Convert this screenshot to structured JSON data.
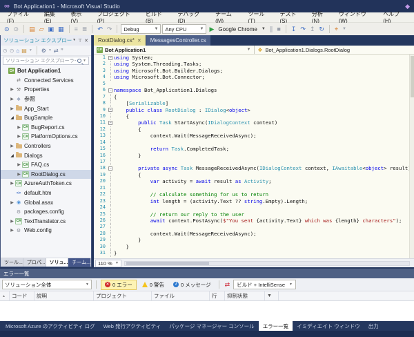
{
  "window": {
    "title": "Bot Application1 - Microsoft Visual Studio"
  },
  "menu": {
    "items": [
      "ファイル(F)",
      "編集(E)",
      "表示(V)",
      "プロジェクト(P)",
      "ビルド(B)",
      "デバッグ(D)",
      "チーム(M)",
      "ツール(T)",
      "テスト(S)",
      "分析(N)",
      "ウィンドウ(W)",
      "ヘルプ(H)"
    ]
  },
  "toolbar": {
    "config": "Debug",
    "platform": "Any CPU",
    "run_target": "Google Chrome"
  },
  "solution_explorer": {
    "title": "ソリューション エクスプローラー",
    "search_placeholder": "ソリューション エクスプローラー の検...",
    "tree": [
      {
        "label": "Bot Application1",
        "lvl": 0,
        "icon": "proj",
        "arrow": "none",
        "sel": false
      },
      {
        "label": "Connected Services",
        "lvl": 1,
        "icon": "svc",
        "arrow": "none",
        "sel": false
      },
      {
        "label": "Properties",
        "lvl": 1,
        "icon": "wrench",
        "arrow": "right",
        "sel": false
      },
      {
        "label": "参照",
        "lvl": 1,
        "icon": "ref",
        "arrow": "right",
        "sel": false
      },
      {
        "label": "App_Start",
        "lvl": 1,
        "icon": "folder",
        "arrow": "right",
        "sel": false
      },
      {
        "label": "BugSample",
        "lvl": 1,
        "icon": "folder",
        "arrow": "down",
        "sel": false
      },
      {
        "label": "BugReport.cs",
        "lvl": 2,
        "icon": "cs",
        "arrow": "right",
        "sel": false
      },
      {
        "label": "PlatformOptions.cs",
        "lvl": 2,
        "icon": "cs",
        "arrow": "right",
        "sel": false
      },
      {
        "label": "Controllers",
        "lvl": 1,
        "icon": "folder",
        "arrow": "right",
        "sel": false
      },
      {
        "label": "Dialogs",
        "lvl": 1,
        "icon": "folder",
        "arrow": "down",
        "sel": false
      },
      {
        "label": "FAQ.cs",
        "lvl": 2,
        "icon": "cs",
        "arrow": "right",
        "sel": false
      },
      {
        "label": "RootDialog.cs",
        "lvl": 2,
        "icon": "cs",
        "arrow": "right",
        "sel": true
      },
      {
        "label": "AzureAuthToken.cs",
        "lvl": 1,
        "icon": "cs",
        "arrow": "right",
        "sel": false
      },
      {
        "label": "default.htm",
        "lvl": 1,
        "icon": "htm",
        "arrow": "none",
        "sel": false
      },
      {
        "label": "Global.asax",
        "lvl": 1,
        "icon": "asax",
        "arrow": "right",
        "sel": false
      },
      {
        "label": "packages.config",
        "lvl": 1,
        "icon": "cfg",
        "arrow": "none",
        "sel": false
      },
      {
        "label": "TextTranslator.cs",
        "lvl": 1,
        "icon": "cs",
        "arrow": "right",
        "sel": false
      },
      {
        "label": "Web.config",
        "lvl": 1,
        "icon": "cfg",
        "arrow": "right",
        "sel": false
      }
    ],
    "bottom_tabs": [
      {
        "label": "ツール...",
        "state": "normal"
      },
      {
        "label": "プロパ...",
        "state": "normal"
      },
      {
        "label": "ソリュ...",
        "state": "active"
      },
      {
        "label": "チーム...",
        "state": "team"
      }
    ]
  },
  "editor": {
    "tabs": [
      {
        "label": "RootDialog.cs",
        "modified": "*",
        "active": true
      },
      {
        "label": "MessagesController.cs",
        "modified": "",
        "active": false
      }
    ],
    "breadcrumb_left": "Bot Application1",
    "breadcrumb_right": "Bot_Application1.Dialogs.RootDialog",
    "zoom": "110 %",
    "lines": [
      {
        "n": 1,
        "f": "b",
        "seg": [
          [
            "k",
            "using"
          ],
          [
            "p",
            " System;"
          ]
        ]
      },
      {
        "n": 2,
        "f": "v",
        "seg": [
          [
            "k",
            "using"
          ],
          [
            "p",
            " System.Threading.Tasks;"
          ]
        ]
      },
      {
        "n": 3,
        "f": "v",
        "seg": [
          [
            "k",
            "using"
          ],
          [
            "p",
            " Microsoft.Bot.Builder.Dialogs;"
          ]
        ]
      },
      {
        "n": 4,
        "f": "v",
        "seg": [
          [
            "k",
            "using"
          ],
          [
            "p",
            " Microsoft.Bot.Connector;"
          ]
        ]
      },
      {
        "n": 5,
        "f": "",
        "seg": []
      },
      {
        "n": 6,
        "f": "b",
        "seg": [
          [
            "k",
            "namespace"
          ],
          [
            "p",
            " Bot_Application1.Dialogs"
          ]
        ]
      },
      {
        "n": 7,
        "f": "v",
        "seg": [
          [
            "p",
            "{"
          ]
        ]
      },
      {
        "n": 8,
        "f": "v",
        "seg": [
          [
            "p",
            "    ["
          ],
          [
            "t",
            "Serializable"
          ],
          [
            "p",
            "]"
          ]
        ]
      },
      {
        "n": 9,
        "f": "b",
        "seg": [
          [
            "p",
            "    "
          ],
          [
            "k",
            "public"
          ],
          [
            "p",
            " "
          ],
          [
            "k",
            "class"
          ],
          [
            "p",
            " "
          ],
          [
            "t",
            "RootDialog"
          ],
          [
            "p",
            " : "
          ],
          [
            "t",
            "IDialog"
          ],
          [
            "p",
            "<"
          ],
          [
            "k",
            "object"
          ],
          [
            "p",
            ">"
          ]
        ]
      },
      {
        "n": 10,
        "f": "v",
        "seg": [
          [
            "p",
            "    {"
          ]
        ]
      },
      {
        "n": 11,
        "f": "b",
        "seg": [
          [
            "p",
            "        "
          ],
          [
            "k",
            "public"
          ],
          [
            "p",
            " "
          ],
          [
            "t",
            "Task"
          ],
          [
            "p",
            " StartAsync("
          ],
          [
            "t",
            "IDialogContext"
          ],
          [
            "p",
            " context)"
          ]
        ]
      },
      {
        "n": 12,
        "f": "v",
        "seg": [
          [
            "p",
            "        {"
          ]
        ]
      },
      {
        "n": 13,
        "f": "v",
        "seg": [
          [
            "p",
            "            context.Wait(MessageReceivedAsync);"
          ]
        ]
      },
      {
        "n": 14,
        "f": "v",
        "seg": []
      },
      {
        "n": 15,
        "f": "v",
        "seg": [
          [
            "p",
            "            "
          ],
          [
            "k",
            "return"
          ],
          [
            "p",
            " "
          ],
          [
            "t",
            "Task"
          ],
          [
            "p",
            ".CompletedTask;"
          ]
        ]
      },
      {
        "n": 16,
        "f": "v",
        "seg": [
          [
            "p",
            "        }"
          ]
        ]
      },
      {
        "n": 17,
        "f": "v",
        "seg": []
      },
      {
        "n": 18,
        "f": "b",
        "seg": [
          [
            "p",
            "        "
          ],
          [
            "k",
            "private"
          ],
          [
            "p",
            " "
          ],
          [
            "k",
            "async"
          ],
          [
            "p",
            " "
          ],
          [
            "t",
            "Task"
          ],
          [
            "p",
            " MessageReceivedAsync("
          ],
          [
            "t",
            "IDialogContext"
          ],
          [
            "p",
            " context, "
          ],
          [
            "t",
            "IAwaitable"
          ],
          [
            "p",
            "<"
          ],
          [
            "k",
            "object"
          ],
          [
            "p",
            "> result)"
          ]
        ]
      },
      {
        "n": 19,
        "f": "v",
        "seg": [
          [
            "p",
            "        {"
          ]
        ]
      },
      {
        "n": 20,
        "f": "v",
        "seg": [
          [
            "p",
            "            "
          ],
          [
            "k",
            "var"
          ],
          [
            "p",
            " activity = "
          ],
          [
            "k",
            "await"
          ],
          [
            "p",
            " result "
          ],
          [
            "k",
            "as"
          ],
          [
            "p",
            " "
          ],
          [
            "t",
            "Activity"
          ],
          [
            "p",
            ";"
          ]
        ]
      },
      {
        "n": 21,
        "f": "v",
        "seg": []
      },
      {
        "n": 22,
        "f": "v",
        "seg": [
          [
            "p",
            "            "
          ],
          [
            "c",
            "// calculate something for us to return"
          ]
        ]
      },
      {
        "n": 23,
        "f": "v",
        "seg": [
          [
            "p",
            "            "
          ],
          [
            "k",
            "int"
          ],
          [
            "p",
            " length = (activity.Text ?? "
          ],
          [
            "k",
            "string"
          ],
          [
            "p",
            ".Empty).Length;"
          ]
        ]
      },
      {
        "n": 24,
        "f": "v",
        "seg": []
      },
      {
        "n": 25,
        "f": "v",
        "seg": [
          [
            "p",
            "            "
          ],
          [
            "c",
            "// return our reply to the user"
          ]
        ]
      },
      {
        "n": 26,
        "f": "v",
        "seg": [
          [
            "p",
            "            "
          ],
          [
            "k",
            "await"
          ],
          [
            "p",
            " context.PostAsync("
          ],
          [
            "s",
            "$\"You sent "
          ],
          [
            "p",
            "{activity.Text}"
          ],
          [
            "s",
            " which was "
          ],
          [
            "p",
            "{length}"
          ],
          [
            "s",
            " characters\""
          ],
          [
            "p",
            ");"
          ]
        ]
      },
      {
        "n": 27,
        "f": "v",
        "seg": []
      },
      {
        "n": 28,
        "f": "v",
        "seg": [
          [
            "p",
            "            context.Wait(MessageReceivedAsync);"
          ]
        ]
      },
      {
        "n": 29,
        "f": "v",
        "seg": [
          [
            "p",
            "        }"
          ]
        ]
      },
      {
        "n": 30,
        "f": "v",
        "seg": [
          [
            "p",
            "    }"
          ]
        ]
      },
      {
        "n": 31,
        "f": "v",
        "seg": [
          [
            "p",
            "}"
          ]
        ]
      }
    ]
  },
  "error_list": {
    "title": "エラー一覧",
    "scope": "ソリューション全体",
    "errors_label": "0 エラー",
    "warnings_label": "0 警告",
    "messages_label": "0 メッセージ",
    "source_label": "ビルド + IntelliSense",
    "columns": [
      "コード",
      "説明",
      "プロジェクト",
      "ファイル",
      "行",
      "抑制状態"
    ]
  },
  "bottom_tabs": [
    {
      "label": "Microsoft Azure のアクティビティ ログ",
      "active": false
    },
    {
      "label": "Web 発行アクティビティ",
      "active": false
    },
    {
      "label": "パッケージ マネージャー コンソール",
      "active": false
    },
    {
      "label": "エラー一覧",
      "active": true
    },
    {
      "label": "イミディエイト ウィンドウ",
      "active": false
    },
    {
      "label": "出力",
      "active": false
    }
  ],
  "colors": {
    "accent_tab": "#ece5a1",
    "shell": "#24375e",
    "error_red": "#d02b2b",
    "warn_yellow": "#f5c41e",
    "info_blue": "#2e7ad0"
  }
}
